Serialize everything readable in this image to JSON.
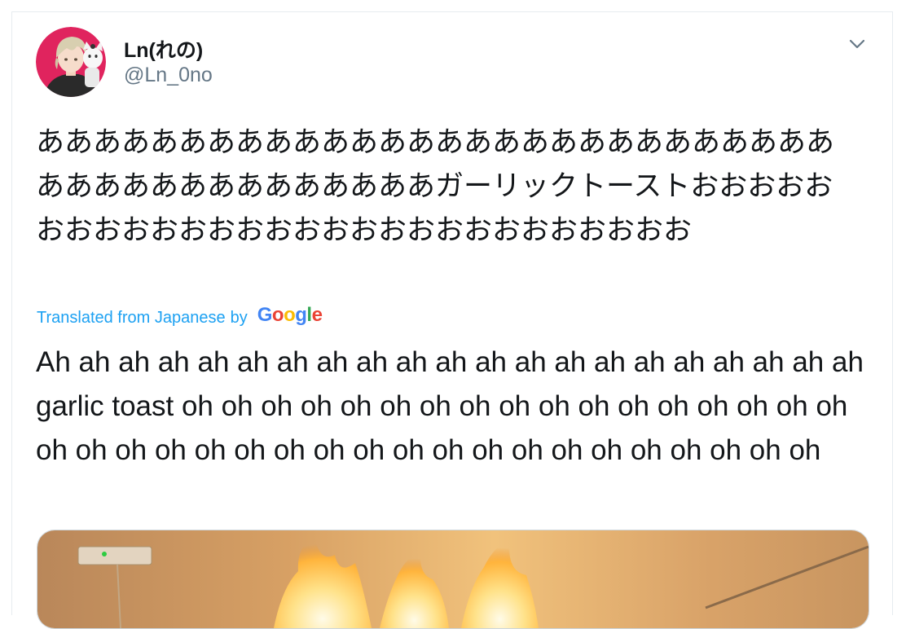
{
  "tweet": {
    "display_name": "Ln(れの)",
    "handle": "@Ln_0no",
    "text_original": "ああああああああああああああああああああああああああああああああああああああああああガーリックトーストおおおおおおおおおおおおおおおおおおおおおおおおおおおお",
    "translated_label": "Translated from Japanese",
    "translated_by": "by",
    "translator": "Google",
    "text_translated": "Ah ah ah ah ah ah ah ah ah ah ah ah ah ah ah ah ah ah ah ah ah garlic toast oh oh oh oh oh oh oh oh oh oh oh oh oh oh oh oh oh oh oh oh oh oh oh oh oh oh oh oh oh oh oh oh oh oh oh oh oh"
  },
  "icons": {
    "menu": "chevron-down-icon",
    "avatar": "profile-avatar"
  },
  "colors": {
    "link_blue": "#1da1f2",
    "text_primary": "#14171a",
    "text_secondary": "#657786",
    "avatar_ring": "#e0245e",
    "google_blue": "#4285f4",
    "google_red": "#ea4335",
    "google_yellow": "#fbbc05",
    "google_green": "#34a853"
  }
}
